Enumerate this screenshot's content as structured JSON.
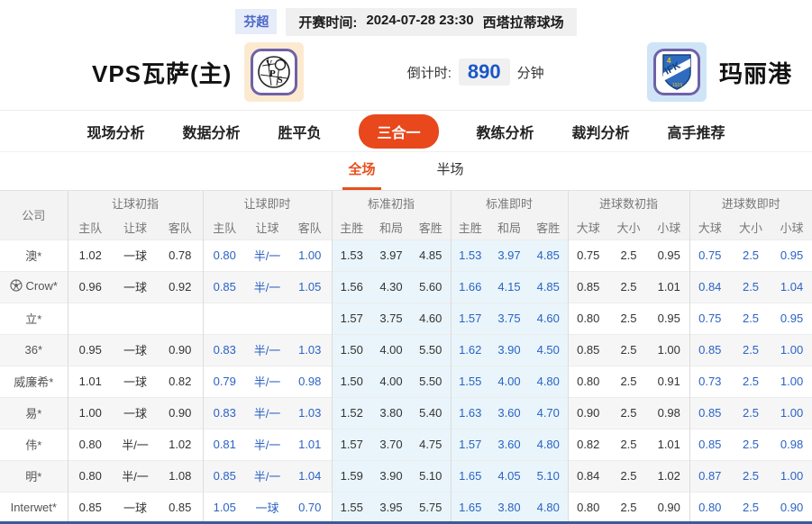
{
  "top": {
    "league": "芬超",
    "kickoff_label": "开赛时间:",
    "kickoff_time": "2024-07-28 23:30",
    "venue": "西塔拉蒂球场"
  },
  "match": {
    "home": {
      "name": "VPS瓦萨(主)",
      "logo_text": "VPS"
    },
    "away": {
      "name": "玛丽港",
      "logo_text": "IFK"
    },
    "countdown": {
      "label": "倒计时:",
      "value": "890",
      "unit": "分钟"
    }
  },
  "nav": {
    "tabs": [
      {
        "label": "现场分析",
        "active": false
      },
      {
        "label": "数据分析",
        "active": false
      },
      {
        "label": "胜平负",
        "active": false
      },
      {
        "label": "三合一",
        "active": true
      },
      {
        "label": "教练分析",
        "active": false
      },
      {
        "label": "裁判分析",
        "active": false
      },
      {
        "label": "高手推荐",
        "active": false
      }
    ]
  },
  "subtabs": [
    {
      "label": "全场",
      "active": true
    },
    {
      "label": "半场",
      "active": false
    }
  ],
  "odds_table": {
    "company_header": "公司",
    "groups": [
      {
        "label": "让球初指",
        "cols": [
          "主队",
          "让球",
          "客队"
        ],
        "live": false,
        "tint": false
      },
      {
        "label": "让球即时",
        "cols": [
          "主队",
          "让球",
          "客队"
        ],
        "live": true,
        "tint": false
      },
      {
        "label": "标准初指",
        "cols": [
          "主胜",
          "和局",
          "客胜"
        ],
        "live": false,
        "tint": true
      },
      {
        "label": "标准即时",
        "cols": [
          "主胜",
          "和局",
          "客胜"
        ],
        "live": true,
        "tint": true
      },
      {
        "label": "进球数初指",
        "cols": [
          "大球",
          "大小",
          "小球"
        ],
        "live": false,
        "tint": false
      },
      {
        "label": "进球数即时",
        "cols": [
          "大球",
          "大小",
          "小球"
        ],
        "live": true,
        "tint": false
      }
    ],
    "rows": [
      {
        "company": "澳*",
        "icon": false,
        "cells": [
          [
            "1.02",
            "一球",
            "0.78"
          ],
          [
            "0.80",
            "半/一",
            "1.00"
          ],
          [
            "1.53",
            "3.97",
            "4.85"
          ],
          [
            "1.53",
            "3.97",
            "4.85"
          ],
          [
            "0.75",
            "2.5",
            "0.95"
          ],
          [
            "0.75",
            "2.5",
            "0.95"
          ]
        ]
      },
      {
        "company": "Crow*",
        "icon": true,
        "cells": [
          [
            "0.96",
            "一球",
            "0.92"
          ],
          [
            "0.85",
            "半/一",
            "1.05"
          ],
          [
            "1.56",
            "4.30",
            "5.60"
          ],
          [
            "1.66",
            "4.15",
            "4.85"
          ],
          [
            "0.85",
            "2.5",
            "1.01"
          ],
          [
            "0.84",
            "2.5",
            "1.04"
          ]
        ]
      },
      {
        "company": "立*",
        "icon": false,
        "cells": [
          [
            "",
            "",
            ""
          ],
          [
            "",
            "",
            ""
          ],
          [
            "1.57",
            "3.75",
            "4.60"
          ],
          [
            "1.57",
            "3.75",
            "4.60"
          ],
          [
            "0.80",
            "2.5",
            "0.95"
          ],
          [
            "0.75",
            "2.5",
            "0.95"
          ]
        ]
      },
      {
        "company": "36*",
        "icon": false,
        "cells": [
          [
            "0.95",
            "一球",
            "0.90"
          ],
          [
            "0.83",
            "半/一",
            "1.03"
          ],
          [
            "1.50",
            "4.00",
            "5.50"
          ],
          [
            "1.62",
            "3.90",
            "4.50"
          ],
          [
            "0.85",
            "2.5",
            "1.00"
          ],
          [
            "0.85",
            "2.5",
            "1.00"
          ]
        ]
      },
      {
        "company": "威廉希*",
        "icon": false,
        "cells": [
          [
            "1.01",
            "一球",
            "0.82"
          ],
          [
            "0.79",
            "半/一",
            "0.98"
          ],
          [
            "1.50",
            "4.00",
            "5.50"
          ],
          [
            "1.55",
            "4.00",
            "4.80"
          ],
          [
            "0.80",
            "2.5",
            "0.91"
          ],
          [
            "0.73",
            "2.5",
            "1.00"
          ]
        ]
      },
      {
        "company": "易*",
        "icon": false,
        "cells": [
          [
            "1.00",
            "一球",
            "0.90"
          ],
          [
            "0.83",
            "半/一",
            "1.03"
          ],
          [
            "1.52",
            "3.80",
            "5.40"
          ],
          [
            "1.63",
            "3.60",
            "4.70"
          ],
          [
            "0.90",
            "2.5",
            "0.98"
          ],
          [
            "0.85",
            "2.5",
            "1.00"
          ]
        ]
      },
      {
        "company": "伟*",
        "icon": false,
        "cells": [
          [
            "0.80",
            "半/一",
            "1.02"
          ],
          [
            "0.81",
            "半/一",
            "1.01"
          ],
          [
            "1.57",
            "3.70",
            "4.75"
          ],
          [
            "1.57",
            "3.60",
            "4.80"
          ],
          [
            "0.82",
            "2.5",
            "1.01"
          ],
          [
            "0.85",
            "2.5",
            "0.98"
          ]
        ]
      },
      {
        "company": "明*",
        "icon": false,
        "cells": [
          [
            "0.80",
            "半/一",
            "1.08"
          ],
          [
            "0.85",
            "半/一",
            "1.04"
          ],
          [
            "1.59",
            "3.90",
            "5.10"
          ],
          [
            "1.65",
            "4.05",
            "5.10"
          ],
          [
            "0.84",
            "2.5",
            "1.02"
          ],
          [
            "0.87",
            "2.5",
            "1.00"
          ]
        ]
      },
      {
        "company": "Interwet*",
        "icon": false,
        "cells": [
          [
            "0.85",
            "一球",
            "0.85"
          ],
          [
            "1.05",
            "一球",
            "0.70"
          ],
          [
            "1.55",
            "3.95",
            "5.75"
          ],
          [
            "1.65",
            "3.80",
            "4.80"
          ],
          [
            "0.80",
            "2.5",
            "0.90"
          ],
          [
            "0.80",
            "2.5",
            "0.90"
          ]
        ]
      }
    ]
  },
  "colors": {
    "accent_orange": "#e8481c",
    "subtab_orange": "#e8501e",
    "live_odds_blue": "#2b62c4",
    "countdown_blue": "#1a56c8",
    "league_badge_blue": "#4a67c8",
    "standard_tint": "#e9f5fa"
  }
}
